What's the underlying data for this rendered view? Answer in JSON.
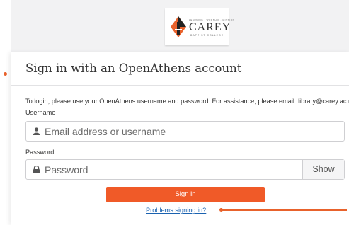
{
  "brand": {
    "name": "CAREY",
    "tagline_top": "LEARNING · WORSHIP · MISSION",
    "tagline_bottom": "BAPTIST COLLEGE"
  },
  "login": {
    "title": "Sign in with an OpenAthens account",
    "instructions": "To login, please use your OpenAthens username and password. For assistance, please email: library@carey.ac.nz",
    "username_label": "Username",
    "username_placeholder": "Email address or username",
    "password_label": "Password",
    "password_placeholder": "Password",
    "show_label": "Show",
    "signin_label": "Sign in",
    "problems_link": "Problems signing in?"
  },
  "colors": {
    "accent": "#f05a28",
    "link": "#1a62b0",
    "annotation": "#e8622c"
  }
}
